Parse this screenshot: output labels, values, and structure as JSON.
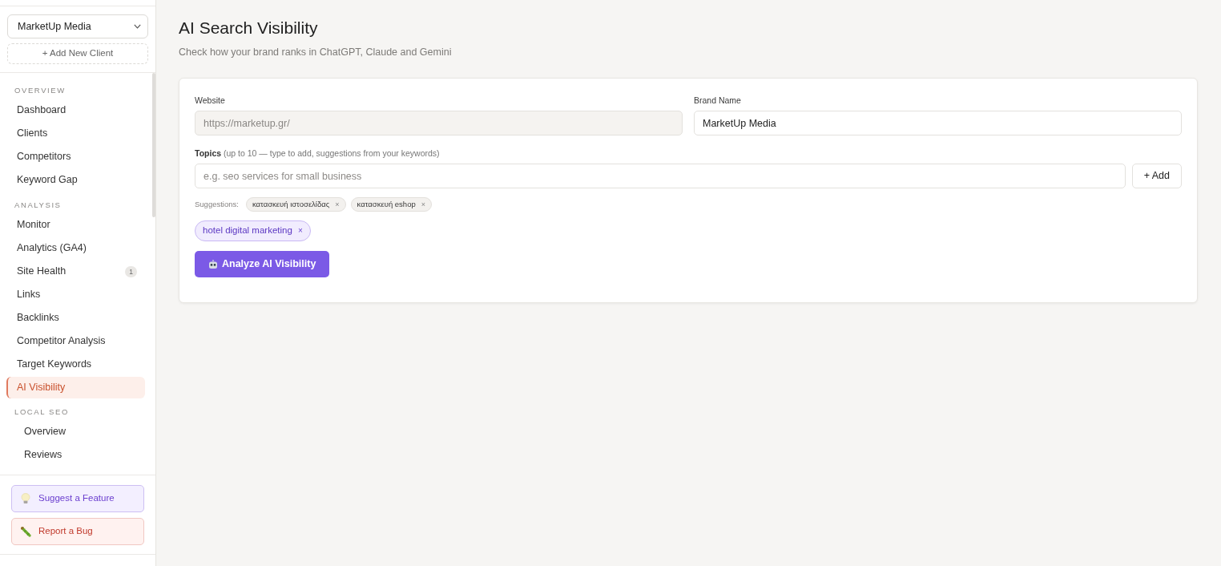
{
  "sidebar": {
    "client_select": {
      "value": "MarketUp Media"
    },
    "add_client": "+ Add New Client",
    "sections": [
      {
        "heading": "OVERVIEW",
        "kind": "flat",
        "items": [
          {
            "label": "Dashboard",
            "selected": false
          },
          {
            "label": "Clients",
            "selected": false
          },
          {
            "label": "Competitors",
            "selected": false
          },
          {
            "label": "Keyword Gap",
            "selected": false
          }
        ]
      },
      {
        "heading": "ANALYSIS",
        "kind": "flat",
        "items": [
          {
            "label": "Monitor",
            "selected": false
          },
          {
            "label": "Analytics (GA4)",
            "selected": false
          },
          {
            "label": "Site Health",
            "selected": false,
            "badge": "1"
          },
          {
            "label": "Links",
            "selected": false
          },
          {
            "label": "Backlinks",
            "selected": false
          },
          {
            "label": "Competitor Analysis",
            "selected": false
          },
          {
            "label": "Target Keywords",
            "selected": false
          },
          {
            "label": "AI Visibility",
            "selected": true
          }
        ]
      },
      {
        "heading": "LOCAL SEO",
        "kind": "nested",
        "items": [
          {
            "label": "Overview",
            "selected": false
          },
          {
            "label": "Reviews",
            "selected": false
          }
        ]
      }
    ],
    "actions": [
      {
        "kind": "suggest",
        "label": "Suggest a Feature"
      },
      {
        "kind": "bug",
        "label": "Report a Bug"
      }
    ]
  },
  "page": {
    "title": "AI Search Visibility",
    "subtitle": "Check how your brand ranks in ChatGPT, Claude and Gemini"
  },
  "form": {
    "website": {
      "label": "Website",
      "value": "https://marketup.gr/",
      "disabled": true
    },
    "brand": {
      "label": "Brand Name",
      "value": "MarketUp Media",
      "disabled": false
    },
    "topics": {
      "label": "**Topics** (up to 10 — type to add, suggestions from your keywords)",
      "placeholder": "e.g. seo services for small business",
      "add_button": "+ Add"
    },
    "suggestions_label": "Suggestions:",
    "suggestions": [
      {
        "label": "κατασκευή ιστοσελίδας",
        "remove": "×"
      },
      {
        "label": "κατασκευή eshop",
        "remove": "×"
      }
    ],
    "selected_topics": [
      {
        "label": "hotel digital marketing",
        "remove": "×"
      }
    ],
    "analyze_button": "Analyze AI Visibility"
  }
}
